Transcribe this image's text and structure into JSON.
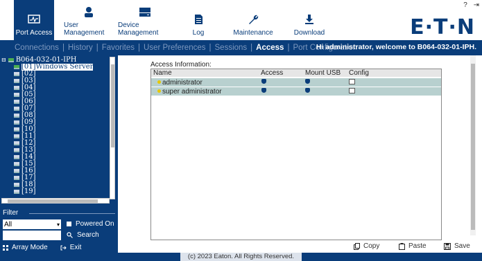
{
  "top_nav": {
    "items": [
      {
        "label": "Port Access",
        "icon": "port-access-icon"
      },
      {
        "label": "User Management",
        "icon": "user-icon"
      },
      {
        "label": "Device Management",
        "icon": "device-icon"
      },
      {
        "label": "Log",
        "icon": "document-icon"
      },
      {
        "label": "Maintenance",
        "icon": "wrench-icon"
      },
      {
        "label": "Download",
        "icon": "download-icon"
      }
    ],
    "logo": "E·T·N",
    "help_icon": "?",
    "logout_icon": "⇥"
  },
  "sub_nav": {
    "items": [
      "Connections",
      "History",
      "Favorites",
      "User Preferences",
      "Sessions",
      "Access",
      "Port Configuration"
    ],
    "active": "Access",
    "welcome": "Hi administrator, welcome to B064-032-01-IPH."
  },
  "sidebar": {
    "root": "B064-032-01-IPH",
    "ports": [
      "[01]Windows Server",
      "[02]",
      "[03]",
      "[04]",
      "[05]",
      "[06]",
      "[07]",
      "[08]",
      "[09]",
      "[10]",
      "[11]",
      "[12]",
      "[13]",
      "[14]",
      "[15]",
      "[16]",
      "[17]",
      "[18]",
      "[19]"
    ],
    "filter_label": "Filter",
    "filter_value": "All",
    "powered_on": "Powered On",
    "search_label": "Search",
    "array_mode": "Array Mode",
    "exit": "Exit"
  },
  "main": {
    "access_info": "Access Information:",
    "columns": [
      "Name",
      "Access",
      "Mount USB",
      "Config"
    ],
    "rows": [
      {
        "name": "administrator"
      },
      {
        "name": "super administrator"
      }
    ]
  },
  "actions": {
    "copy": "Copy",
    "paste": "Paste",
    "save": "Save"
  },
  "footer": {
    "copyright": "(c) 2023 Eaton. All Rights Reserved."
  }
}
